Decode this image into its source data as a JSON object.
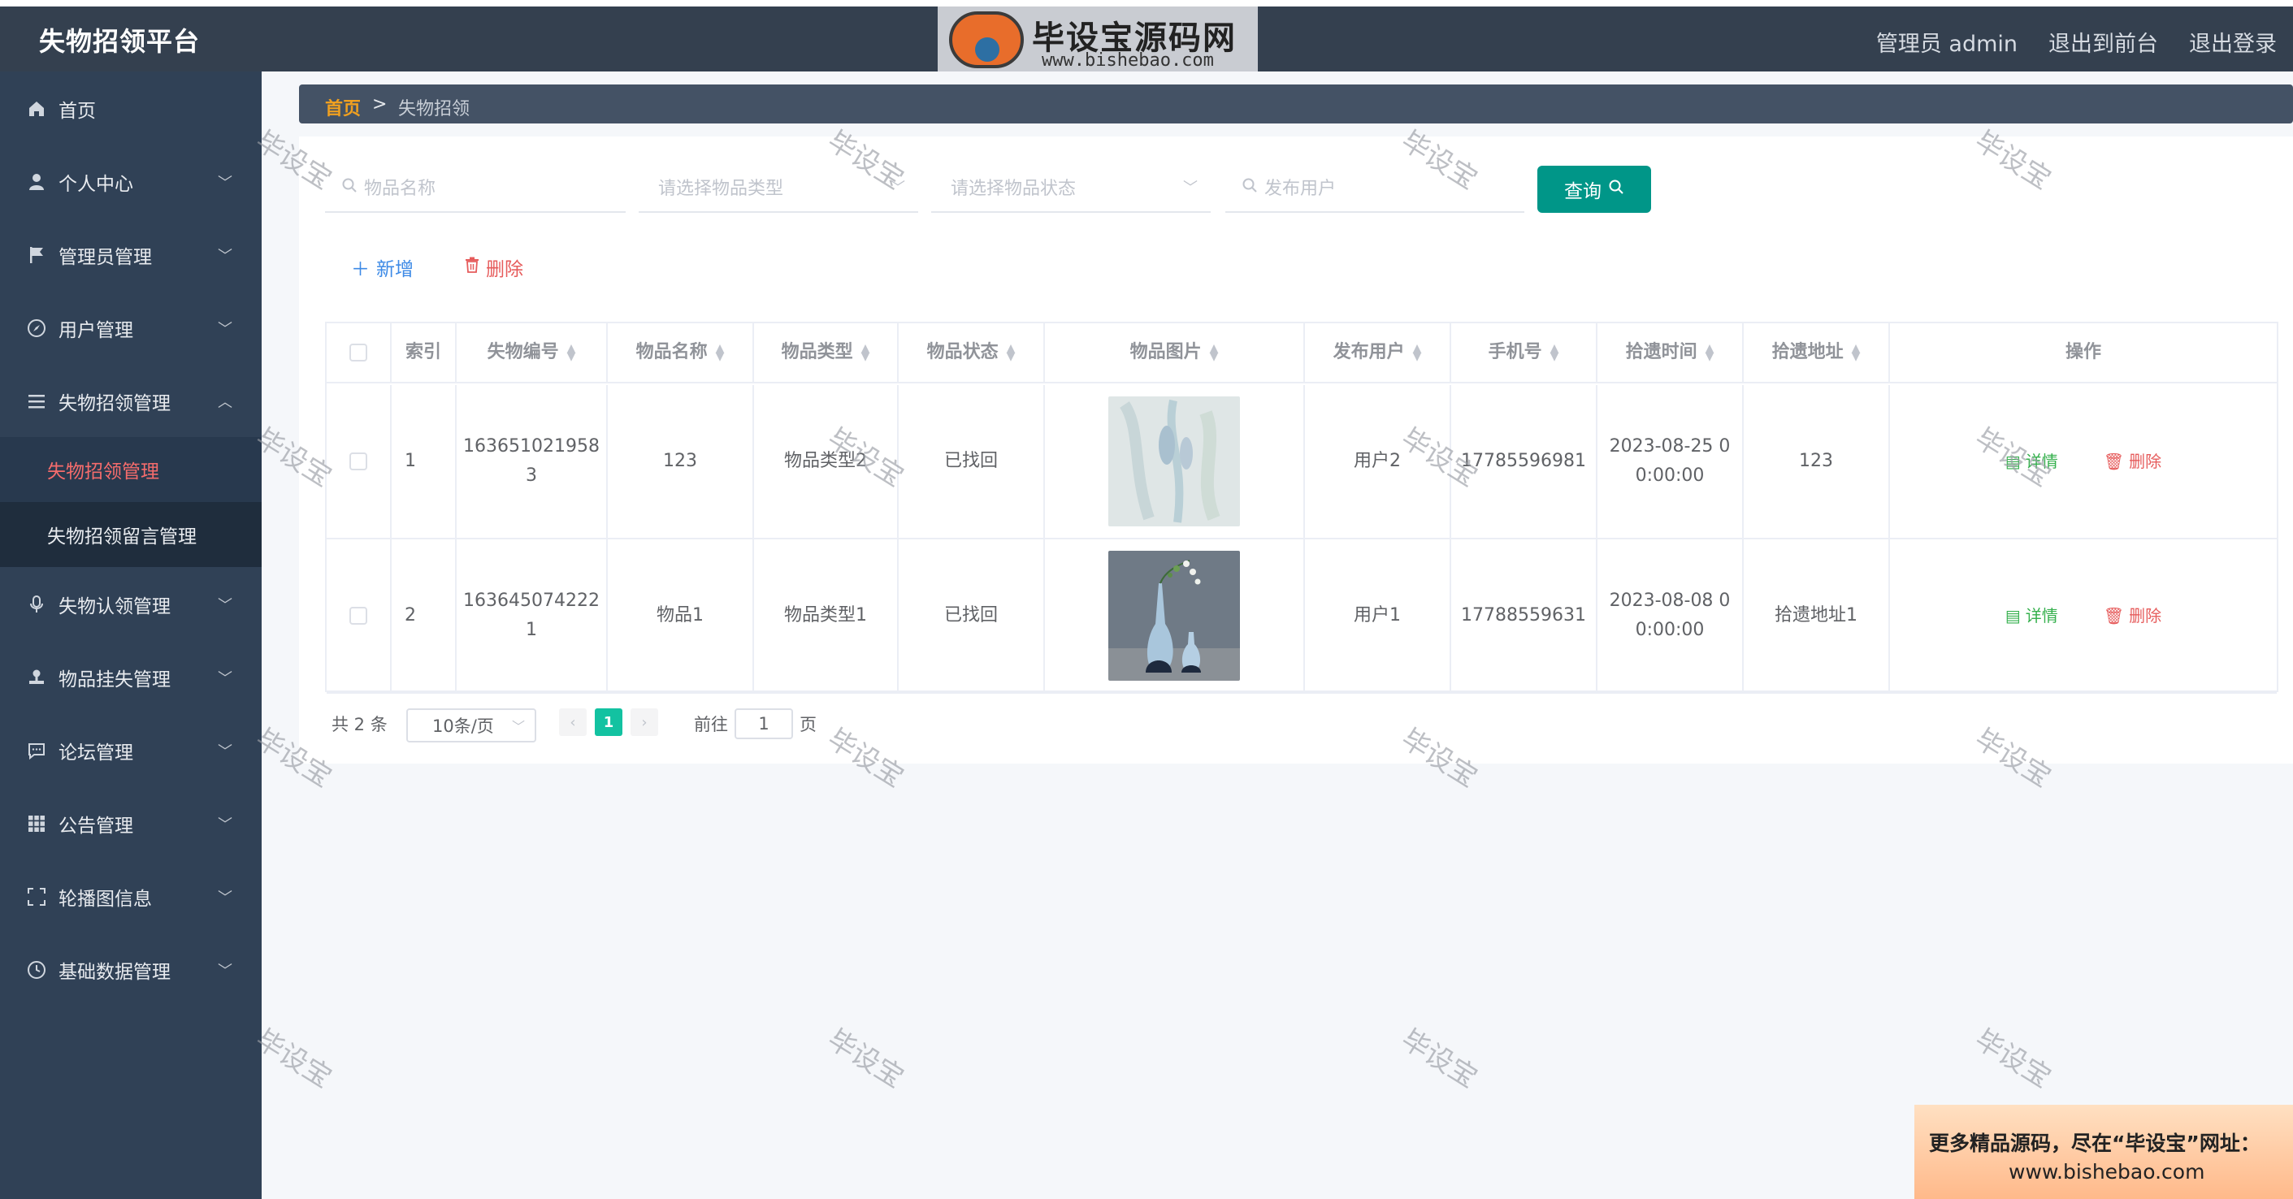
{
  "app": {
    "title": "失物招领平台"
  },
  "header": {
    "user_label": "管理员 admin",
    "to_front": "退出到前台",
    "logout": "退出登录",
    "logo_text": "毕设宝源码网",
    "logo_url": "www.bishebao.com"
  },
  "sidebar": {
    "items": [
      {
        "label": "首页",
        "icon": "home-icon",
        "expandable": false
      },
      {
        "label": "个人中心",
        "icon": "user-icon",
        "expandable": true
      },
      {
        "label": "管理员管理",
        "icon": "flag-icon",
        "expandable": true
      },
      {
        "label": "用户管理",
        "icon": "compass-icon",
        "expandable": true
      },
      {
        "label": "失物招领管理",
        "icon": "list-icon",
        "expandable": true,
        "expanded": true
      },
      {
        "label": "失物认领管理",
        "icon": "microphone-icon",
        "expandable": true
      },
      {
        "label": "物品挂失管理",
        "icon": "user-stamp-icon",
        "expandable": true
      },
      {
        "label": "论坛管理",
        "icon": "chat-icon",
        "expandable": true
      },
      {
        "label": "公告管理",
        "icon": "grid-icon",
        "expandable": true
      },
      {
        "label": "轮播图信息",
        "icon": "fullscreen-icon",
        "expandable": true
      },
      {
        "label": "基础数据管理",
        "icon": "clock-icon",
        "expandable": true
      }
    ],
    "submenu": [
      {
        "label": "失物招领管理",
        "active": true
      },
      {
        "label": "失物招领留言管理",
        "active": false
      }
    ]
  },
  "breadcrumb": {
    "home": "首页",
    "separator": ">",
    "current": "失物招领"
  },
  "filters": {
    "name_placeholder": "物品名称",
    "type_placeholder": "请选择物品类型",
    "status_placeholder": "请选择物品状态",
    "user_placeholder": "发布用户",
    "search_label": "查询"
  },
  "actions": {
    "add_label": "新增",
    "delete_label": "删除"
  },
  "table": {
    "columns": [
      "索引",
      "失物编号",
      "物品名称",
      "物品类型",
      "物品状态",
      "物品图片",
      "发布用户",
      "手机号",
      "拾遗时间",
      "拾遗地址",
      "操作"
    ],
    "rows": [
      {
        "index": "1",
        "code": "1636510219583",
        "name": "123",
        "type": "物品类型2",
        "status": "已找回",
        "image": "abstract-painting-thumbnail",
        "user": "用户2",
        "phone": "17785596981",
        "time": "2023-08-25 00:00:00",
        "address": "123"
      },
      {
        "index": "2",
        "code": "1636450742221",
        "name": "物品1",
        "type": "物品类型1",
        "status": "已找回",
        "image": "vases-thumbnail",
        "user": "用户1",
        "phone": "17788559631",
        "time": "2023-08-08 00:00:00",
        "address": "拾遗地址1"
      }
    ],
    "op_detail": "详情",
    "op_delete": "删除"
  },
  "pagination": {
    "total_text": "共 2 条",
    "page_size": "10条/页",
    "current_page": "1",
    "goto_label": "前往",
    "goto_value": "1",
    "page_suffix": "页"
  },
  "watermark": "毕设宝",
  "promo": {
    "line1": "更多精品源码，尽在“毕设宝”网址：",
    "line2": "www.bishebao.com"
  },
  "colors": {
    "header_bg": "#34404f",
    "sidebar_bg": "#304156",
    "accent": "#009688",
    "active_menu_text": "#f56c6c",
    "breadcrumb_home": "#f0a020"
  }
}
